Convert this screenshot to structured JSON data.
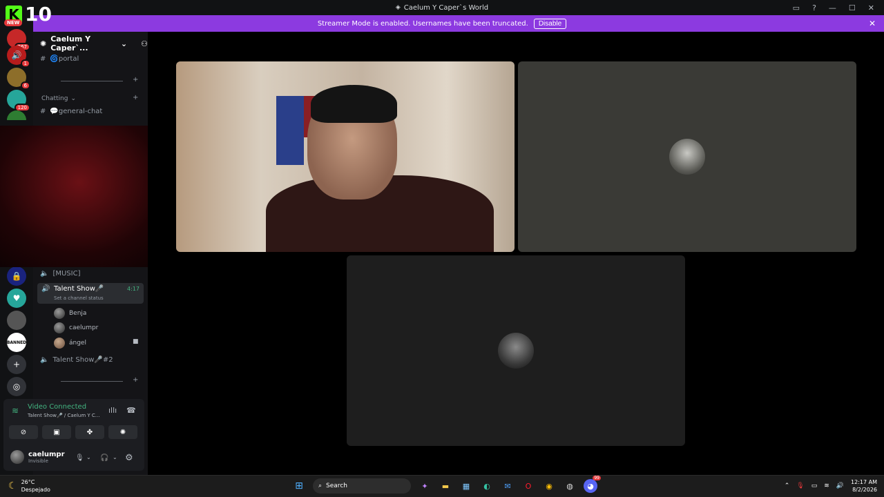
{
  "window": {
    "title": "Caelum Y Caper`s World",
    "controls": [
      "minimize-icon",
      "maximize-icon",
      "close-icon"
    ]
  },
  "banner": {
    "text": "Streamer Mode is enabled. Usernames have been truncated.",
    "button": "Disable"
  },
  "kick_overlay": {
    "count": "10",
    "new_label": "NEW"
  },
  "servers": [
    {
      "badge": "267"
    },
    {
      "badge": "1"
    },
    {
      "badge": "6"
    },
    {
      "badge": "120"
    },
    {
      "badge": ""
    },
    {
      "badge": ""
    },
    {
      "badge": ""
    },
    {
      "badge": ""
    },
    {
      "label": "BANNED"
    }
  ],
  "sidebar": {
    "guild_name": "Caelum Y Caper`...",
    "channels": {
      "portal": "🌀portal",
      "category_chatting": "Chatting",
      "general_chat": "💬general-chat",
      "music": "[MUSIC]",
      "talent_show": "Talent Show🎤",
      "talent_show_timer": "4:17",
      "channel_status": "Set a channel status",
      "talent_show_2": "Talent Show🎤#2"
    },
    "members": [
      "Benja",
      "caelumpr",
      "ángel"
    ]
  },
  "voice_panel": {
    "status": "Video Connected",
    "location": "Talent Show🎤 / Caelum Y C...",
    "username": "caelumpr",
    "presence": "Invisible"
  },
  "taskbar": {
    "weather_temp": "26°C",
    "weather_desc": "Despejado",
    "search_placeholder": "Search",
    "time": "12:17 AM",
    "date": "8/2/2026",
    "discord_badge": "99"
  },
  "colors": {
    "streamer_banner": "#8c3ae0",
    "connected": "#43b581",
    "badge": "#e5383b"
  }
}
